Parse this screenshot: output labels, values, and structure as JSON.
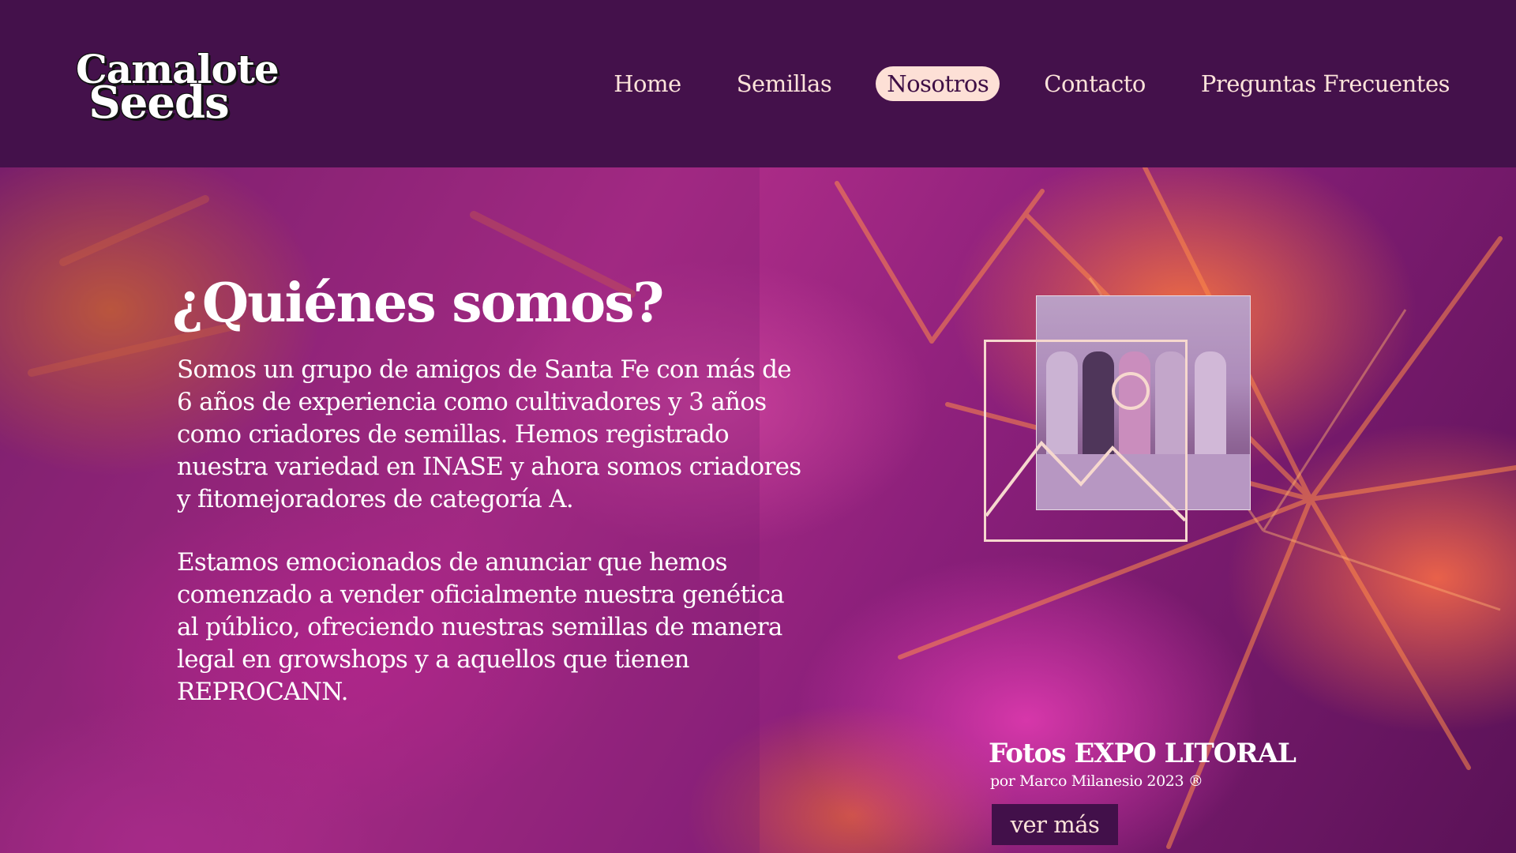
{
  "header": {
    "logo": {
      "line1": "Camalote",
      "line2": "Seeds"
    },
    "nav": [
      "Home",
      "Semillas",
      "Nosotros",
      "Contacto",
      "Preguntas Frecuentes"
    ],
    "active_nav": "Nosotros"
  },
  "about": {
    "title": "¿Quiénes somos?",
    "paragraph1": "Somos un grupo de amigos de Santa Fe con más de 6 años de experiencia como cultivadores y 3 años como criadores de semillas. Hemos registrado nuestra variedad en INASE y ahora somos criadores y fitomejoradores de categoría A.",
    "paragraph2": "Estamos emocionados de anunciar que hemos comenzado a vender oficialmente nuestra genética al público, ofreciendo nuestras semillas de manera legal en growshops y a aquellos que tienen REPROCANN."
  },
  "gallery": {
    "caption_title": "Fotos EXPO LITORAL",
    "caption_sub": "por Marco Milanesio 2023 ®",
    "button": "ver más",
    "icon": "image-placeholder-icon"
  },
  "colors": {
    "header_bg": "#44114b",
    "nav_active_bg": "#fde0d6",
    "button_bg": "#42104a",
    "text_light": "#fde3da"
  }
}
